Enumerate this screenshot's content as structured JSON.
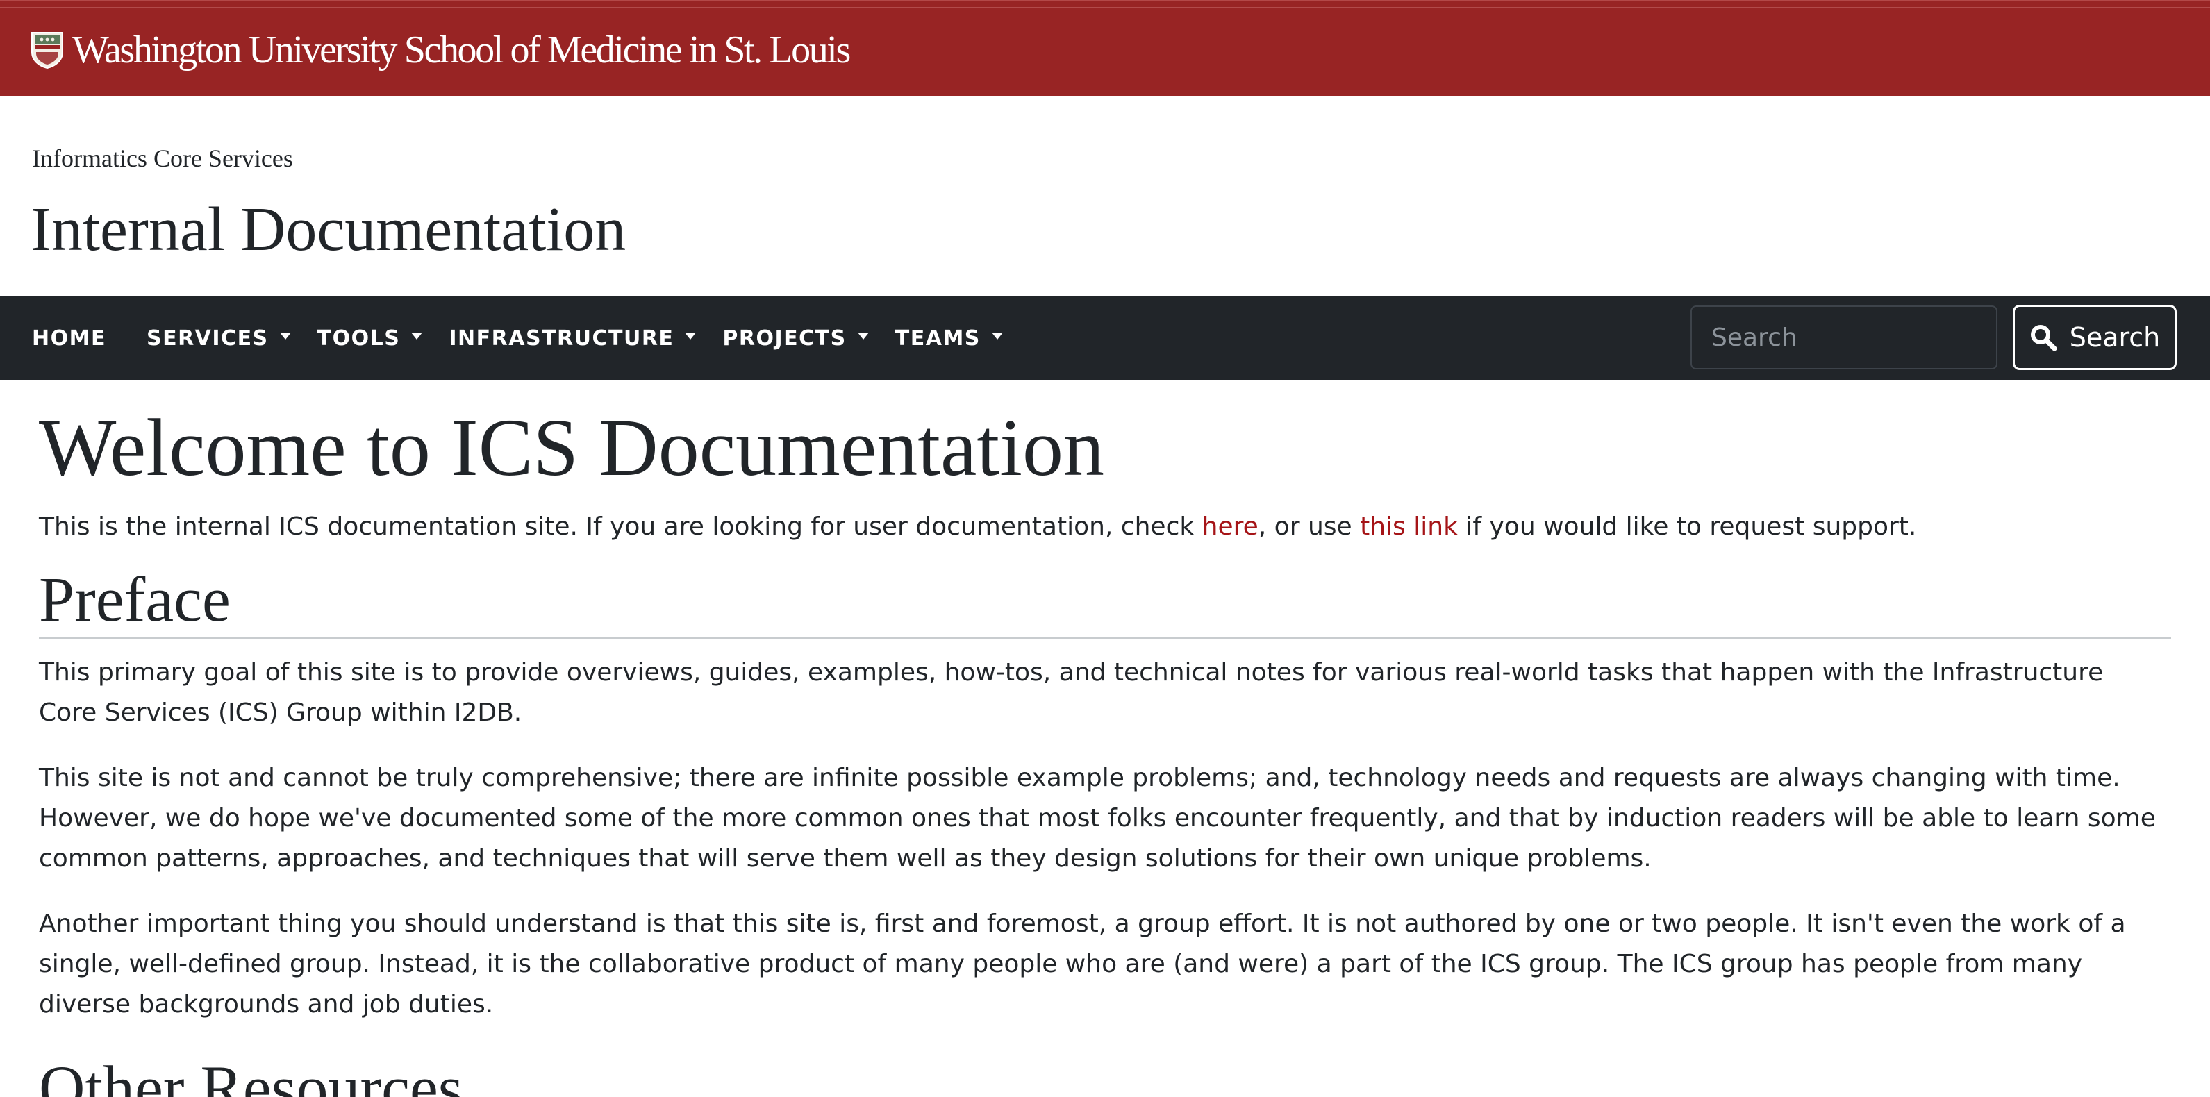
{
  "brand": {
    "university_name": "Washington University School of Medicine in St. Louis",
    "colors": {
      "brand_red": "#982424",
      "nav_dark": "#212529",
      "link_red": "#a51417"
    }
  },
  "site": {
    "subtitle": "Informatics Core Services",
    "title": "Internal Documentation"
  },
  "nav": {
    "items": [
      {
        "label": "HOME",
        "dropdown": false
      },
      {
        "label": "SERVICES",
        "dropdown": true
      },
      {
        "label": "TOOLS",
        "dropdown": true
      },
      {
        "label": "INFRASTRUCTURE",
        "dropdown": true
      },
      {
        "label": "PROJECTS",
        "dropdown": true
      },
      {
        "label": "TEAMS",
        "dropdown": true
      }
    ],
    "search_placeholder": "Search",
    "search_button_label": "Search",
    "search_icon": "magnifier-icon"
  },
  "content": {
    "heading": "Welcome to ICS Documentation",
    "intro": {
      "before_link1": "This is the internal ICS documentation site. If you are looking for user documentation, check ",
      "link1": "here",
      "between_links": ", or use ",
      "link2": "this link",
      "after_link2": " if you would like to request support."
    },
    "preface_heading": "Preface",
    "paragraphs": [
      "This primary goal of this site is to provide overviews, guides, examples, how-tos, and technical notes for various real-world tasks that happen with the Infrastructure Core Services (ICS) Group within I2DB.",
      "This site is not and cannot be truly comprehensive; there are infinite possible example problems; and, technology needs and requests are always changing with time. However, we do hope we've documented some of the more common ones that most folks encounter frequently, and that by induction readers will be able to learn some common patterns, approaches, and techniques that will serve them well as they design solutions for their own unique problems.",
      "Another important thing you should understand is that this site is, first and foremost, a group effort. It is not authored by one or two people. It isn't even the work of a single, well-defined group. Instead, it is the collaborative product of many people who are (and were) a part of the ICS group. The ICS group has people from many diverse backgrounds and job duties."
    ],
    "other_heading": "Other Resources"
  }
}
